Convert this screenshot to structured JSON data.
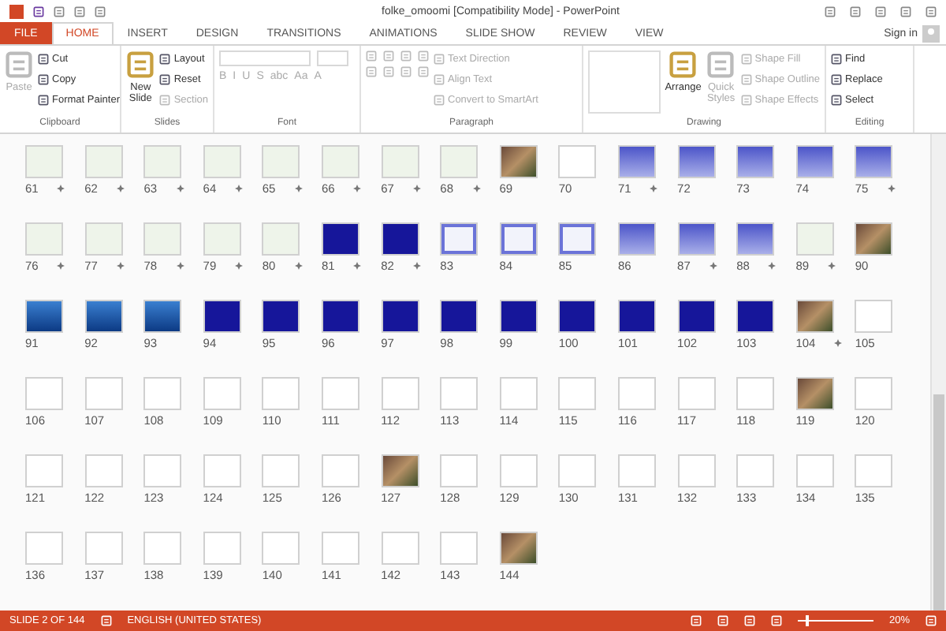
{
  "window": {
    "title": "folke_omoomi [Compatibility Mode] - PowerPoint"
  },
  "tabs": [
    {
      "label": "FILE",
      "kind": "file",
      "selected": false
    },
    {
      "label": "HOME",
      "kind": "tab",
      "selected": true
    },
    {
      "label": "INSERT",
      "kind": "tab",
      "selected": false
    },
    {
      "label": "DESIGN",
      "kind": "tab",
      "selected": false
    },
    {
      "label": "TRANSITIONS",
      "kind": "tab",
      "selected": false
    },
    {
      "label": "ANIMATIONS",
      "kind": "tab",
      "selected": false
    },
    {
      "label": "SLIDE SHOW",
      "kind": "tab",
      "selected": false
    },
    {
      "label": "REVIEW",
      "kind": "tab",
      "selected": false
    },
    {
      "label": "VIEW",
      "kind": "tab",
      "selected": false
    }
  ],
  "account": {
    "label": "Sign in"
  },
  "ribbon": [
    {
      "label": "Clipboard",
      "items": [
        {
          "kind": "large",
          "label": "Paste",
          "disabled": true
        },
        {
          "kind": "small",
          "label": "Cut",
          "disabled": false
        },
        {
          "kind": "small",
          "label": "Copy",
          "disabled": false
        },
        {
          "kind": "small",
          "label": "Format Painter",
          "disabled": false
        }
      ]
    },
    {
      "label": "Slides",
      "items": [
        {
          "kind": "large",
          "label": "New Slide",
          "disabled": false
        },
        {
          "kind": "small",
          "label": "Layout",
          "disabled": false
        },
        {
          "kind": "small",
          "label": "Reset",
          "disabled": false
        },
        {
          "kind": "small",
          "label": "Section",
          "disabled": true
        }
      ]
    },
    {
      "label": "Font",
      "items": [
        {
          "kind": "font"
        }
      ]
    },
    {
      "label": "Paragraph",
      "items": [
        {
          "kind": "paragraph"
        },
        {
          "kind": "small",
          "label": "Text Direction",
          "disabled": true
        },
        {
          "kind": "small",
          "label": "Align Text",
          "disabled": true
        },
        {
          "kind": "small",
          "label": "Convert to SmartArt",
          "disabled": true
        }
      ]
    },
    {
      "label": "Drawing",
      "items": [
        {
          "kind": "gallery"
        },
        {
          "kind": "large",
          "label": "Arrange",
          "disabled": false
        },
        {
          "kind": "large",
          "label": "Quick Styles",
          "disabled": true
        },
        {
          "kind": "small",
          "label": "Shape Fill",
          "disabled": true
        },
        {
          "kind": "small",
          "label": "Shape Outline",
          "disabled": true
        },
        {
          "kind": "small",
          "label": "Shape Effects",
          "disabled": true
        }
      ]
    },
    {
      "label": "Editing",
      "items": [
        {
          "kind": "small",
          "label": "Find",
          "disabled": false
        },
        {
          "kind": "small",
          "label": "Replace",
          "disabled": false
        },
        {
          "kind": "small",
          "label": "Select",
          "disabled": false
        }
      ]
    }
  ],
  "font_buttons": [
    "B",
    "I",
    "U",
    "S",
    "abc",
    "Aa",
    "A"
  ],
  "slides": [
    {
      "number": "61",
      "kind": "green",
      "animation": true
    },
    {
      "number": "62",
      "kind": "green",
      "animation": true
    },
    {
      "number": "63",
      "kind": "green",
      "animation": true
    },
    {
      "number": "64",
      "kind": "green",
      "animation": true
    },
    {
      "number": "65",
      "kind": "green",
      "animation": true
    },
    {
      "number": "66",
      "kind": "green",
      "animation": true
    },
    {
      "number": "67",
      "kind": "green",
      "animation": true
    },
    {
      "number": "68",
      "kind": "green",
      "animation": true
    },
    {
      "number": "69",
      "kind": "photo",
      "animation": false
    },
    {
      "number": "70",
      "kind": "white",
      "animation": false
    },
    {
      "number": "71",
      "kind": "periwinkle",
      "animation": true
    },
    {
      "number": "72",
      "kind": "periwinkle",
      "animation": false
    },
    {
      "number": "73",
      "kind": "periwinkle",
      "animation": false
    },
    {
      "number": "74",
      "kind": "periwinkle",
      "animation": false
    },
    {
      "number": "75",
      "kind": "periwinkle",
      "animation": true
    },
    {
      "number": "76",
      "kind": "green",
      "animation": true
    },
    {
      "number": "77",
      "kind": "green",
      "animation": true
    },
    {
      "number": "78",
      "kind": "green",
      "animation": true
    },
    {
      "number": "79",
      "kind": "green",
      "animation": true
    },
    {
      "number": "80",
      "kind": "green",
      "animation": true
    },
    {
      "number": "81",
      "kind": "navy",
      "animation": true
    },
    {
      "number": "82",
      "kind": "navy",
      "animation": true
    },
    {
      "number": "83",
      "kind": "grid",
      "animation": false
    },
    {
      "number": "84",
      "kind": "grid",
      "animation": false
    },
    {
      "number": "85",
      "kind": "grid",
      "animation": false
    },
    {
      "number": "86",
      "kind": "periwinkle",
      "animation": false
    },
    {
      "number": "87",
      "kind": "periwinkle",
      "animation": true
    },
    {
      "number": "88",
      "kind": "periwinkle",
      "animation": true
    },
    {
      "number": "89",
      "kind": "green",
      "animation": true
    },
    {
      "number": "90",
      "kind": "photo",
      "animation": false
    },
    {
      "number": "91",
      "kind": "ocean",
      "animation": false
    },
    {
      "number": "92",
      "kind": "ocean",
      "animation": false
    },
    {
      "number": "93",
      "kind": "ocean",
      "animation": false
    },
    {
      "number": "94",
      "kind": "navy",
      "animation": false
    },
    {
      "number": "95",
      "kind": "navy",
      "animation": false
    },
    {
      "number": "96",
      "kind": "navy",
      "animation": false
    },
    {
      "number": "97",
      "kind": "navy",
      "animation": false
    },
    {
      "number": "98",
      "kind": "navy",
      "animation": false
    },
    {
      "number": "99",
      "kind": "navy",
      "animation": false
    },
    {
      "number": "100",
      "kind": "navy",
      "animation": false
    },
    {
      "number": "101",
      "kind": "navy",
      "animation": false
    },
    {
      "number": "102",
      "kind": "navy",
      "animation": false
    },
    {
      "number": "103",
      "kind": "navy",
      "animation": false
    },
    {
      "number": "104",
      "kind": "photo",
      "animation": true
    },
    {
      "number": "105",
      "kind": "white",
      "animation": false
    },
    {
      "number": "106",
      "kind": "white",
      "animation": false
    },
    {
      "number": "107",
      "kind": "white",
      "animation": false
    },
    {
      "number": "108",
      "kind": "white",
      "animation": false
    },
    {
      "number": "109",
      "kind": "white",
      "animation": false
    },
    {
      "number": "110",
      "kind": "white",
      "animation": false
    },
    {
      "number": "111",
      "kind": "white",
      "animation": false
    },
    {
      "number": "112",
      "kind": "white",
      "animation": false
    },
    {
      "number": "113",
      "kind": "white",
      "animation": false
    },
    {
      "number": "114",
      "kind": "white",
      "animation": false
    },
    {
      "number": "115",
      "kind": "white",
      "animation": false
    },
    {
      "number": "116",
      "kind": "white",
      "animation": false
    },
    {
      "number": "117",
      "kind": "white",
      "animation": false
    },
    {
      "number": "118",
      "kind": "white",
      "animation": false
    },
    {
      "number": "119",
      "kind": "photo",
      "animation": false
    },
    {
      "number": "120",
      "kind": "white",
      "animation": false
    },
    {
      "number": "121",
      "kind": "white",
      "animation": false
    },
    {
      "number": "122",
      "kind": "white",
      "animation": false
    },
    {
      "number": "123",
      "kind": "white",
      "animation": false
    },
    {
      "number": "124",
      "kind": "white",
      "animation": false
    },
    {
      "number": "125",
      "kind": "white",
      "animation": false
    },
    {
      "number": "126",
      "kind": "white",
      "animation": false
    },
    {
      "number": "127",
      "kind": "photo",
      "animation": false
    },
    {
      "number": "128",
      "kind": "white",
      "animation": false
    },
    {
      "number": "129",
      "kind": "white",
      "animation": false
    },
    {
      "number": "130",
      "kind": "white",
      "animation": false
    },
    {
      "number": "131",
      "kind": "white",
      "animation": false
    },
    {
      "number": "132",
      "kind": "white",
      "animation": false
    },
    {
      "number": "133",
      "kind": "white",
      "animation": false
    },
    {
      "number": "134",
      "kind": "white",
      "animation": false
    },
    {
      "number": "135",
      "kind": "white",
      "animation": false
    },
    {
      "number": "136",
      "kind": "white",
      "animation": false
    },
    {
      "number": "137",
      "kind": "white",
      "animation": false
    },
    {
      "number": "138",
      "kind": "white",
      "animation": false
    },
    {
      "number": "139",
      "kind": "white",
      "animation": false
    },
    {
      "number": "140",
      "kind": "white",
      "animation": false
    },
    {
      "number": "141",
      "kind": "white",
      "animation": false
    },
    {
      "number": "142",
      "kind": "white",
      "animation": false
    },
    {
      "number": "143",
      "kind": "white",
      "animation": false
    },
    {
      "number": "144",
      "kind": "photo",
      "animation": false
    }
  ],
  "status_bar": {
    "slide": "SLIDE 2 OF 144",
    "language": "ENGLISH (UNITED STATES)",
    "zoom": "20%",
    "zoom_slider": {
      "level": 0.1
    }
  }
}
